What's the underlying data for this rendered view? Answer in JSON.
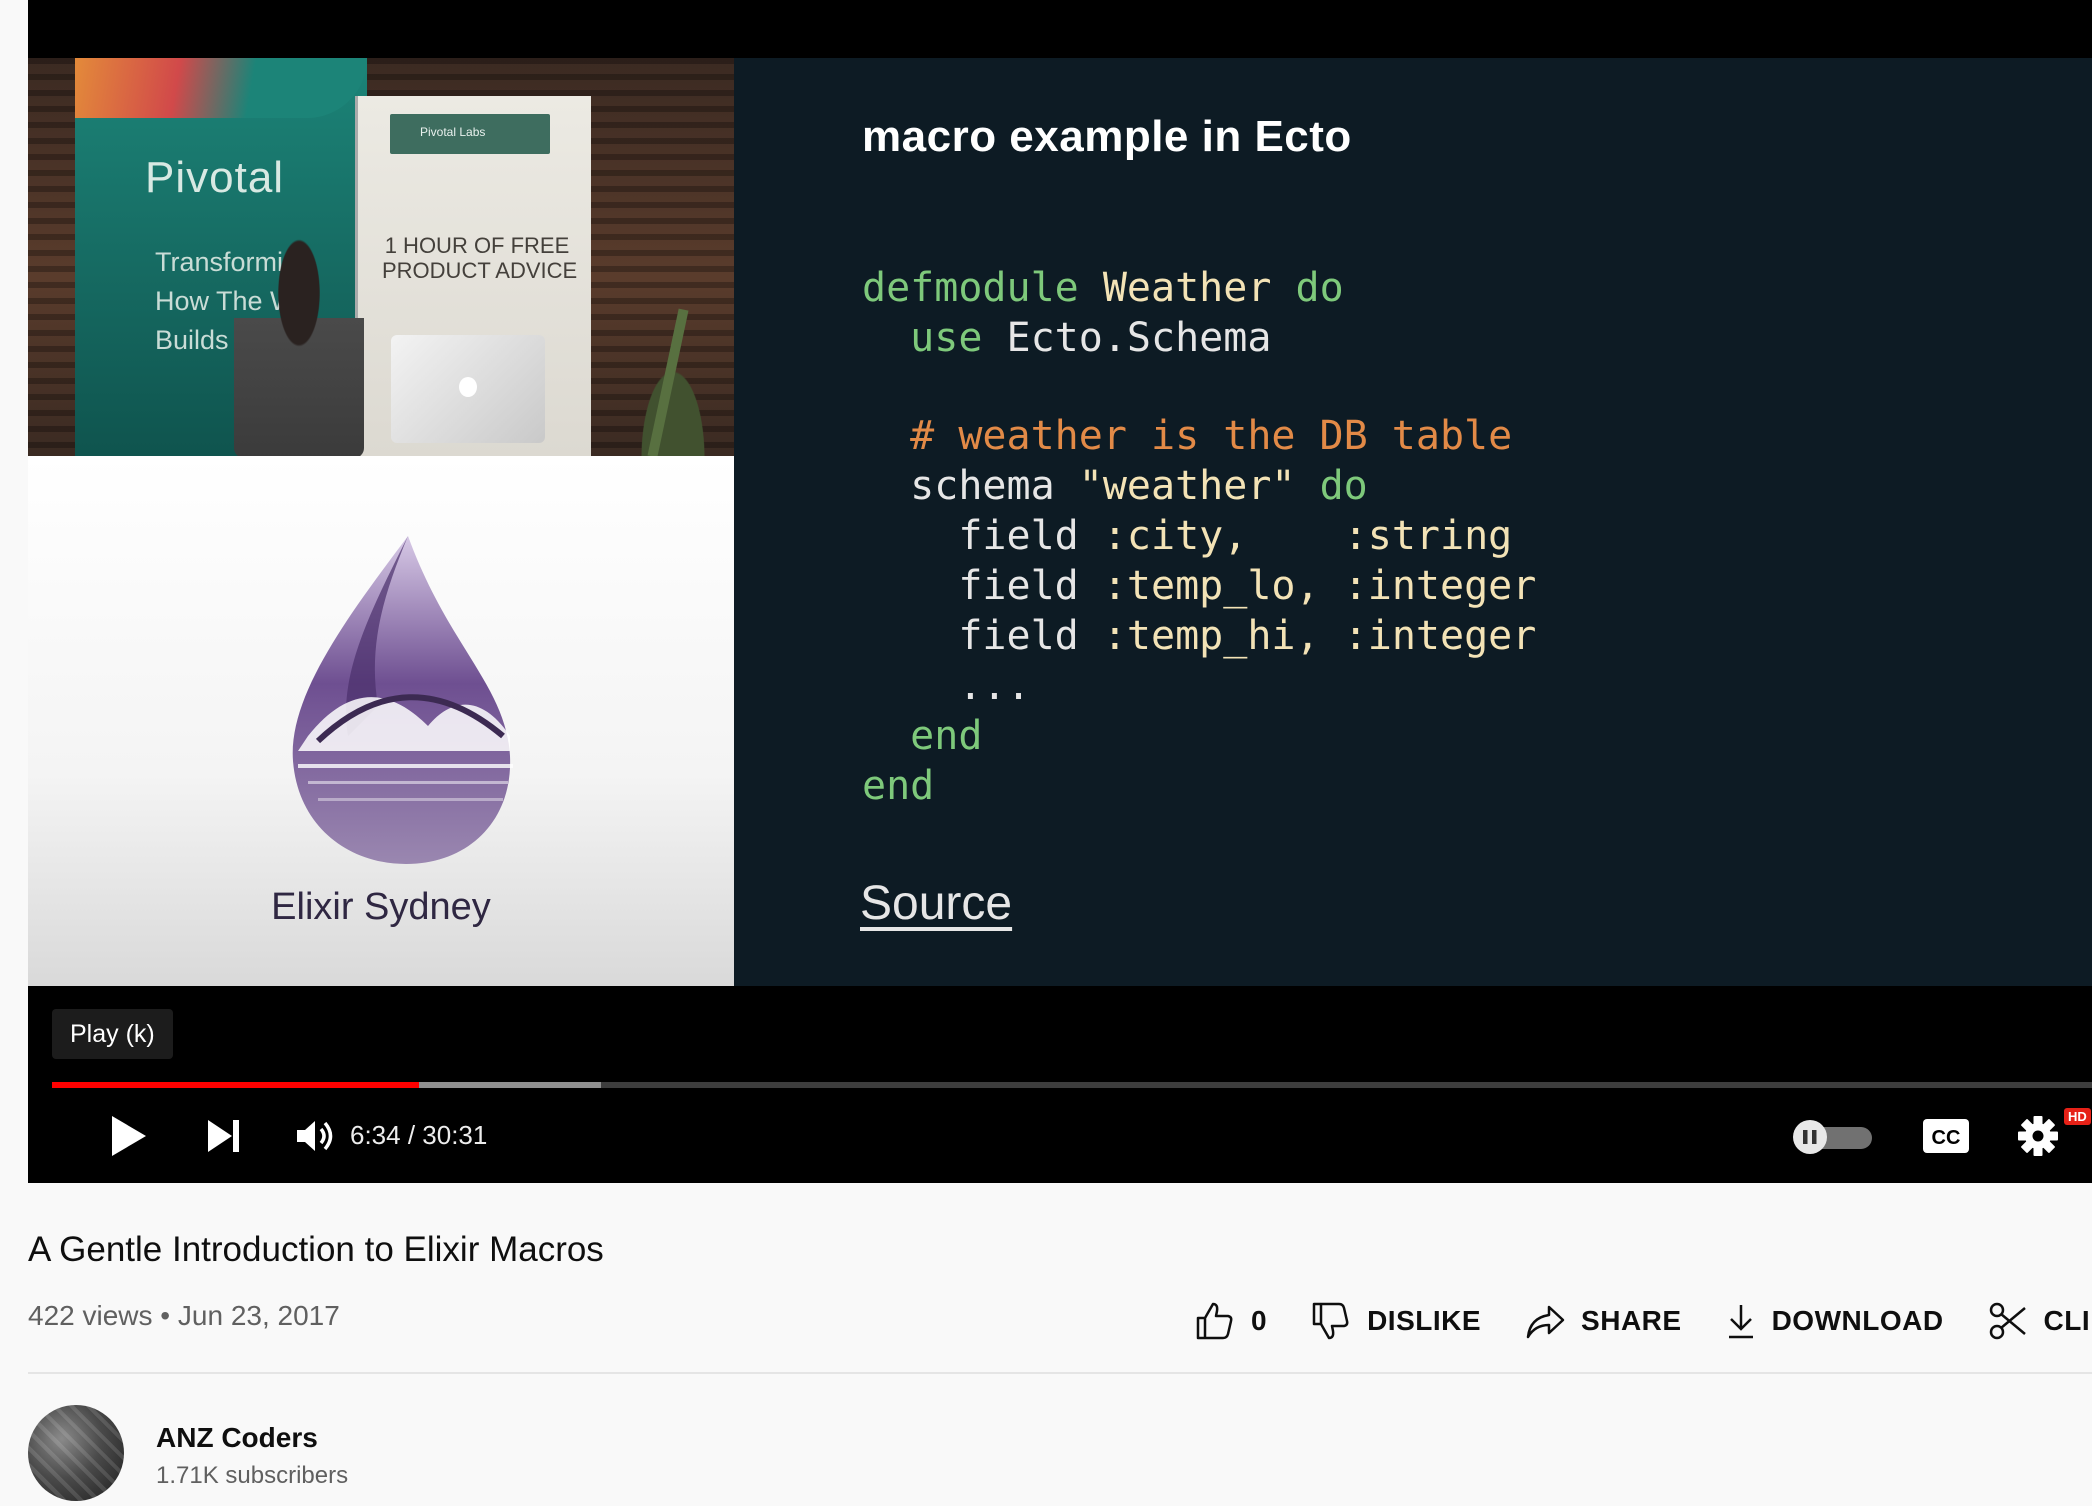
{
  "slide": {
    "title": "macro example in Ecto",
    "source_link": "Source",
    "code_lines": [
      [
        {
          "t": "defmodule ",
          "c": "kw"
        },
        {
          "t": "Weather ",
          "c": "mod"
        },
        {
          "t": "do",
          "c": "kw"
        }
      ],
      [
        {
          "t": "  use ",
          "c": "kw"
        },
        {
          "t": "Ecto.Schema",
          "c": "at"
        }
      ],
      [
        {
          "t": "",
          "c": "at"
        }
      ],
      [
        {
          "t": "  # weather is the DB table",
          "c": "cm"
        }
      ],
      [
        {
          "t": "  schema ",
          "c": "at"
        },
        {
          "t": "\"weather\" ",
          "c": "st"
        },
        {
          "t": "do",
          "c": "kw"
        }
      ],
      [
        {
          "t": "    field ",
          "c": "at"
        },
        {
          "t": ":city,    ",
          "c": "st"
        },
        {
          "t": ":string",
          "c": "st"
        }
      ],
      [
        {
          "t": "    field ",
          "c": "at"
        },
        {
          "t": ":temp_lo, ",
          "c": "st"
        },
        {
          "t": ":integer",
          "c": "st"
        }
      ],
      [
        {
          "t": "    field ",
          "c": "at"
        },
        {
          "t": ":temp_hi, ",
          "c": "st"
        },
        {
          "t": ":integer",
          "c": "st"
        }
      ],
      [
        {
          "t": "    ...",
          "c": "at"
        }
      ],
      [
        {
          "t": "  end",
          "c": "kw"
        }
      ],
      [
        {
          "t": "end",
          "c": "kw"
        }
      ]
    ]
  },
  "camera": {
    "banner_brand": "Pivotal",
    "banner_tagline": "Transformin\nHow The Wo\nBuilds Soft",
    "labs_badge": "Pivotal Labs",
    "labs_offer": "1 HOUR OF FREE\nPRODUCT ADVICE"
  },
  "logo_caption": "Elixir Sydney",
  "player": {
    "tooltip": "Play (k)",
    "time_display": "6:34 / 30:31",
    "played_fraction": 0.18,
    "buffered_fraction": 0.269,
    "hd_badge": "HD",
    "colors": {
      "progress_played": "#ff0000",
      "code_keyword": "#7ec97b",
      "code_comment": "#e28a47"
    },
    "icons": [
      "play-icon",
      "next-icon",
      "volume-icon",
      "autoplay-toggle-icon",
      "captions-icon",
      "settings-icon"
    ]
  },
  "video": {
    "title": "A Gentle Introduction to Elixir Macros",
    "views": "422 views",
    "date": "Jun 23, 2017",
    "separator": "•"
  },
  "actions": {
    "like_count": "0",
    "dislike": "DISLIKE",
    "share": "SHARE",
    "download": "DOWNLOAD",
    "clip": "CLIP"
  },
  "channel": {
    "name": "ANZ Coders",
    "subscribers": "1.71K subscribers"
  }
}
